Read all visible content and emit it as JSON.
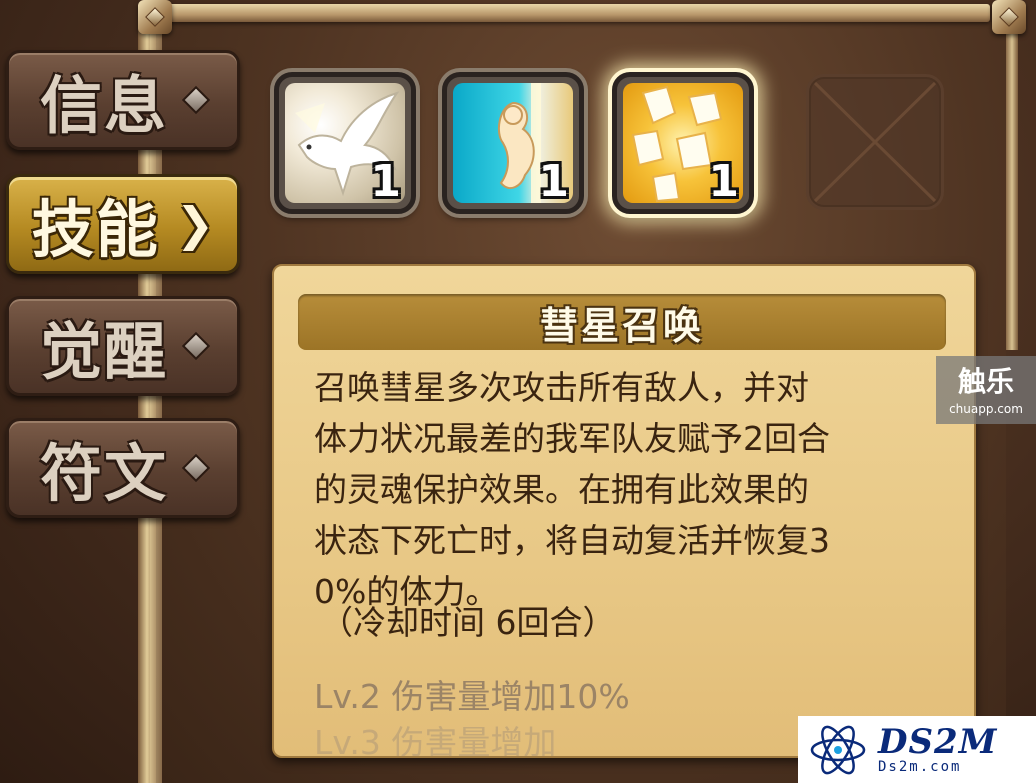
{
  "tabs": [
    {
      "label": "信息",
      "active": false
    },
    {
      "label": "技能",
      "active": true
    },
    {
      "label": "觉醒",
      "active": false
    },
    {
      "label": "符文",
      "active": false
    }
  ],
  "skills": [
    {
      "icon": "white-crow-icon",
      "level": "1"
    },
    {
      "icon": "spirit-shield-icon",
      "level": "1"
    },
    {
      "icon": "golden-crystal-icon",
      "level": "1",
      "selected": true
    },
    {
      "icon": "empty-slot-icon",
      "level": ""
    }
  ],
  "skill_detail": {
    "name": "彗星召唤",
    "description": "召唤彗星多次攻击所有敌人，并对\n体力状况最差的我军队友赋予2回合\n的灵魂保护效果。在拥有此效果的\n状态下死亡时，将自动复活并恢复3\n0%的体力。",
    "cooldown": "（冷却时间 6回合）",
    "upgrade_lv2": "Lv.2 伤害量增加10%",
    "upgrade_lv3": "Lv.3 伤害量增加"
  },
  "watermarks": {
    "chuapp_big": "触乐",
    "chuapp_small": "chuapp.com",
    "ds2m_logo": "DS2M",
    "ds2m_url": "Ds2m.com"
  },
  "colors": {
    "active_tab": "#c89a30",
    "inactive_tab": "#5a3f30",
    "panel": "#ecd08e",
    "title_bar": "#a97f30"
  }
}
